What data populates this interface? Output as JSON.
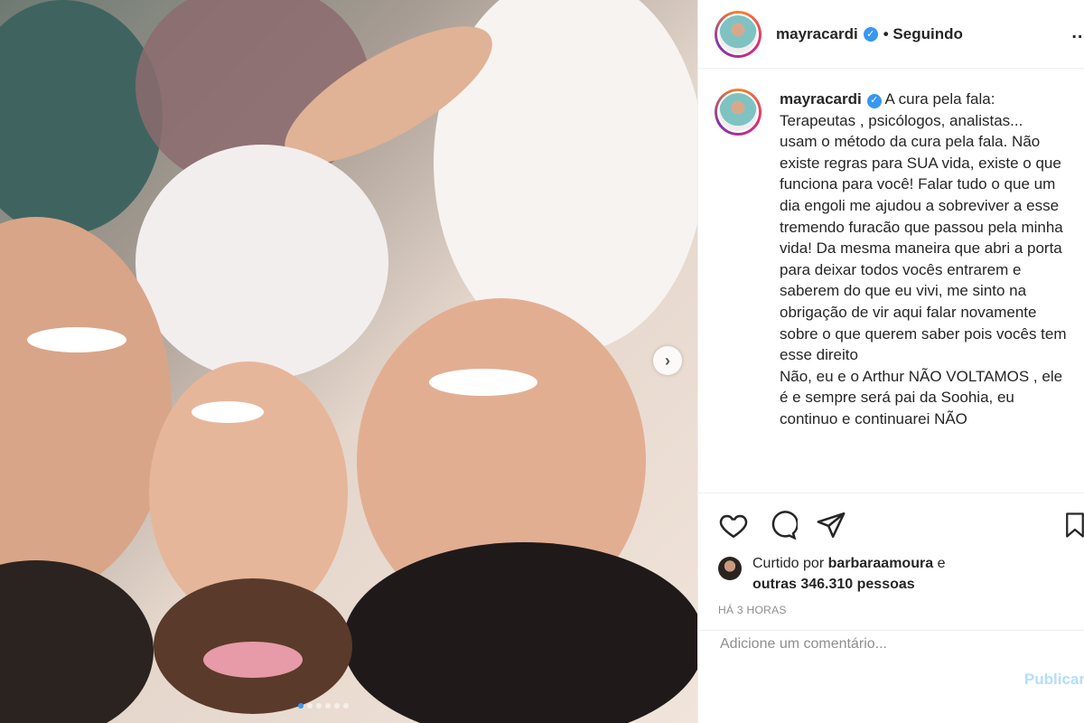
{
  "post": {
    "username": "mayracardi",
    "follow_label": "Seguindo",
    "more_label": "...",
    "next_label": "›",
    "slide_count": 6,
    "active_slide": 1
  },
  "caption": {
    "username": "mayracardi",
    "text": "A cura pela fala:\nTerapeutas , psicólogos, analistas...\nusam o método da cura pela fala. Não existe regras para SUA vida, existe o que funciona para você! Falar tudo o que um dia engoli me ajudou a sobreviver a esse tremendo furacão que passou pela minha vida! Da mesma maneira que abri a porta para deixar todos vocês entrarem e saberem do que eu vivi, me sinto na obrigação de vir aqui falar novamente sobre o que querem saber pois vocês tem esse direito\nNão, eu e o Arthur NÃO VOLTAMOS , ele é e sempre será pai da Soohia, eu continuo e continuarei NÃO"
  },
  "likes": {
    "prefix": "Curtido por",
    "liker": "barbaraamoura",
    "conj": "e",
    "others": "outras 346.310 pessoas"
  },
  "time_label": "HÁ 3 HORAS",
  "comment": {
    "placeholder": "Adicione um comentário...",
    "publish_label": "Publicar"
  },
  "icons": {
    "like": "heart-icon",
    "comment": "comment-icon",
    "share": "paper-plane-icon",
    "save": "bookmark-icon",
    "verified": "verified-badge-icon"
  },
  "colors": {
    "accent": "#3897f0",
    "publish_disabled": "#b2dffc",
    "muted": "#8e8e8e"
  }
}
